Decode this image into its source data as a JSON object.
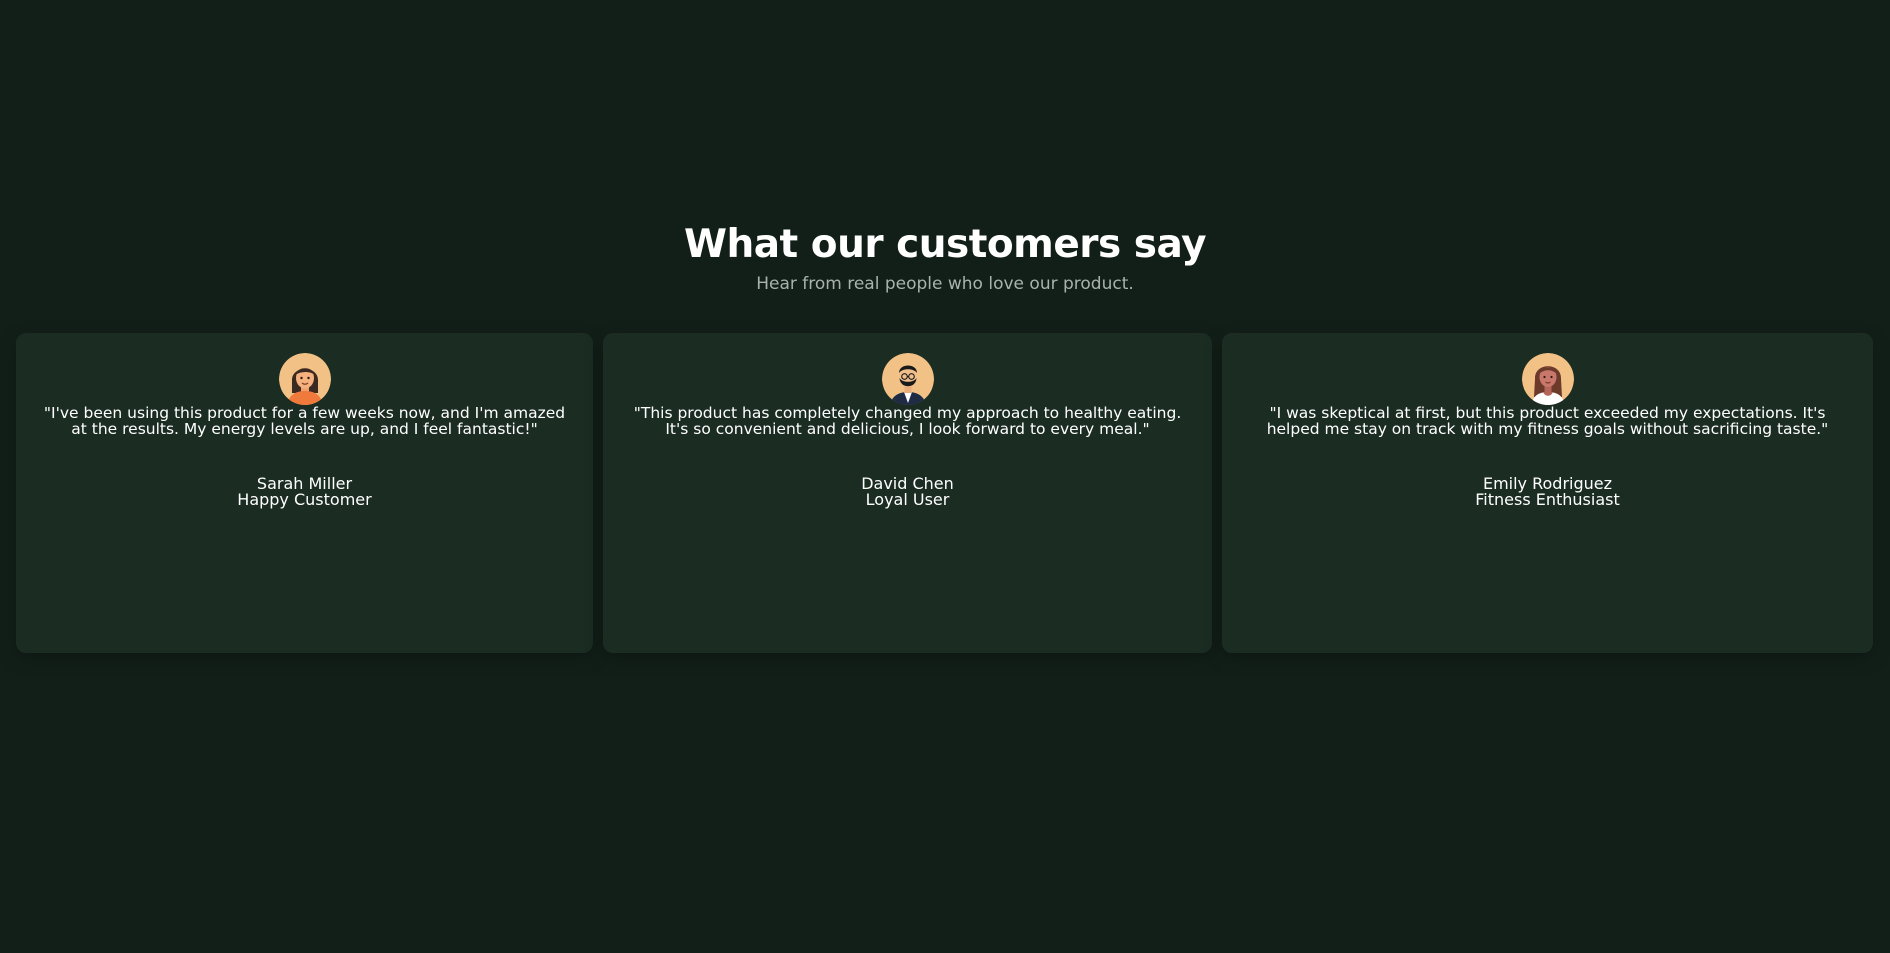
{
  "section": {
    "title": "What our customers say",
    "subtitle": "Hear from real people who love our product."
  },
  "testimonials": [
    {
      "quote": "\"I've been using this product for a few weeks now, and I'm amazed at the results. My energy levels are up, and I feel fantastic!\"",
      "name": "Sarah Miller",
      "role": "Happy Customer",
      "avatar_icon": "woman-avatar-icon"
    },
    {
      "quote": "\"This product has completely changed my approach to healthy eating. It's so convenient and delicious, I look forward to every meal.\"",
      "name": "David Chen",
      "role": "Loyal User",
      "avatar_icon": "bearded-man-avatar-icon"
    },
    {
      "quote": "\"I was skeptical at first, but this product exceeded my expectations. It's helped me stay on track with my fitness goals without sacrificing taste.\"",
      "name": "Emily Rodriguez",
      "role": "Fitness Enthusiast",
      "avatar_icon": "woman-long-hair-avatar-icon"
    }
  ],
  "colors": {
    "background": "#121f18",
    "card": "#1b2c23",
    "text": "#ffffff",
    "muted": "#a9b2ad",
    "avatar_bg": "#f2c185"
  }
}
